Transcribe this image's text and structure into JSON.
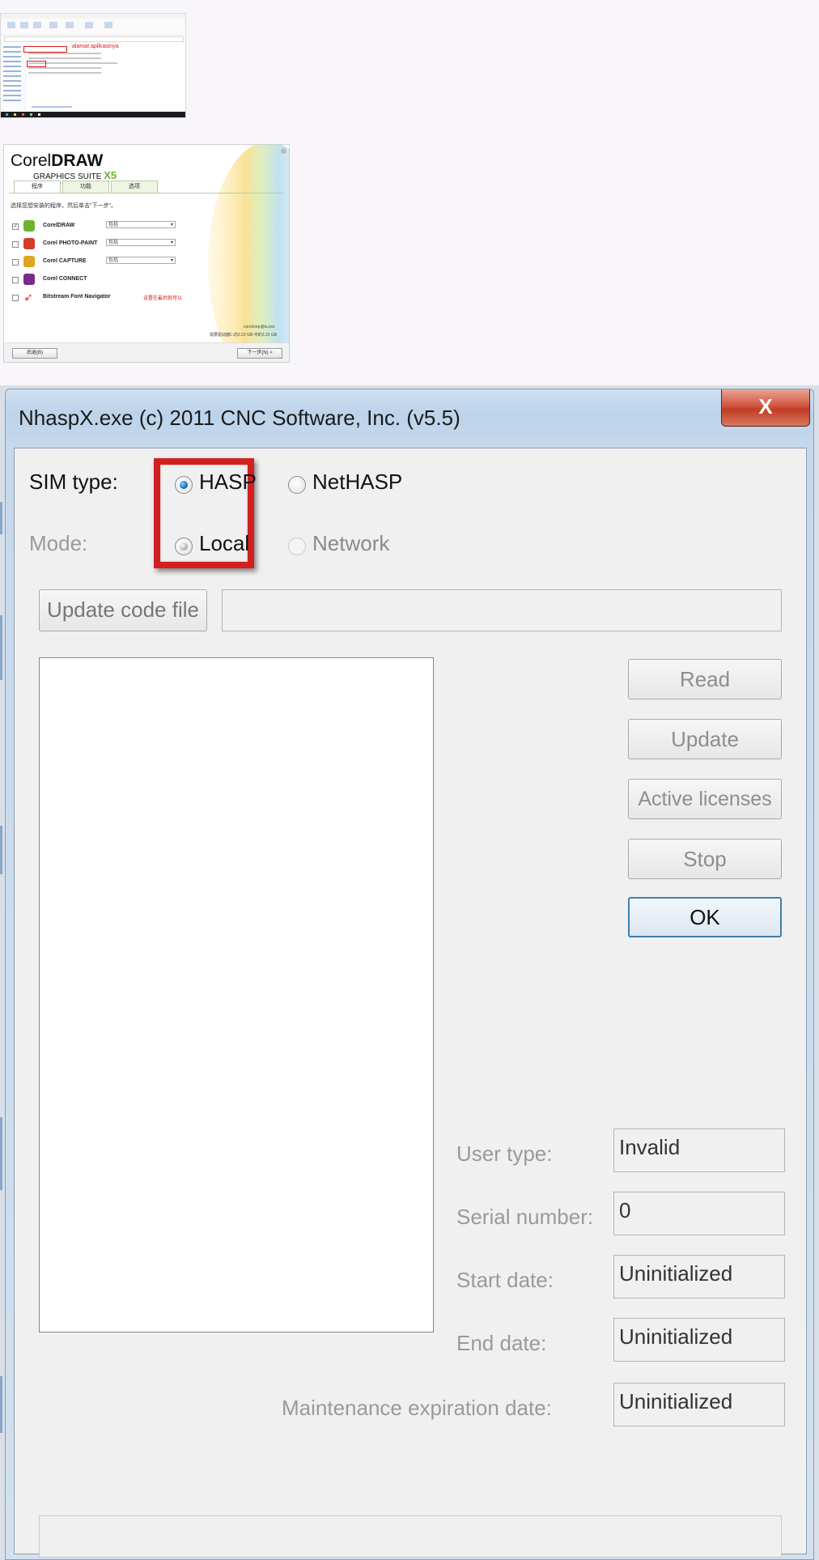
{
  "thumb1": {
    "label": "alamat aplikasinya"
  },
  "thumb2": {
    "logo_light": "Corel",
    "logo_bold": "DRAW",
    "subtitle": "GRAPHICS SUITE",
    "subtitle_version": "X5",
    "tabs": [
      "程序",
      "功能",
      "选项"
    ],
    "instruction": "选择您想安装的程序，然后单击\"下一步\"。",
    "items": [
      {
        "name": "CorelDRAW",
        "select": "包括",
        "checked": true,
        "icon_color": "#6fb32c"
      },
      {
        "name": "Corel PHOTO-PAINT",
        "select": "包括",
        "checked": false,
        "icon_color": "#d63b2a"
      },
      {
        "name": "Corel CAPTURE",
        "select": "包括",
        "checked": false,
        "icon_color": "#e0a51f"
      },
      {
        "name": "Corel CONNECT",
        "select": "",
        "checked": false,
        "icon_color": "#7a2b8a"
      },
      {
        "name": "Bitstream Font Navigator",
        "select": "",
        "checked": false,
        "icon_color": "#c93333"
      }
    ],
    "red_note": "设置在最后就可以",
    "footer_line1": "corelcorp@lu.xxx",
    "footer_line2": "需要驱动器C:的2.22 GB 中的2.22 GB",
    "back_button": "后退(B)",
    "next_button": "下一步(N) >"
  },
  "dialog": {
    "title": "NhaspX.exe (c) 2011 CNC Software, Inc. (v5.5)",
    "close_label": "X",
    "sim_type_label": "SIM type:",
    "mode_label": "Mode:",
    "radio_hasp": "HASP",
    "radio_nethasp": "NetHASP",
    "radio_local": "Local",
    "radio_network": "Network",
    "update_code_file_button": "Update code file",
    "code_file_path": "",
    "buttons": {
      "read": "Read",
      "update": "Update",
      "active_licenses": "Active licenses",
      "stop": "Stop",
      "ok": "OK"
    },
    "fields": {
      "user_type_label": "User type:",
      "user_type_value": "Invalid",
      "serial_number_label": "Serial number:",
      "serial_number_value": "0",
      "start_date_label": "Start date:",
      "start_date_value": "Uninitialized",
      "end_date_label": "End date:",
      "end_date_value": "Uninitialized",
      "maintenance_label": "Maintenance expiration date:",
      "maintenance_value": "Uninitialized"
    },
    "status_text": ""
  }
}
